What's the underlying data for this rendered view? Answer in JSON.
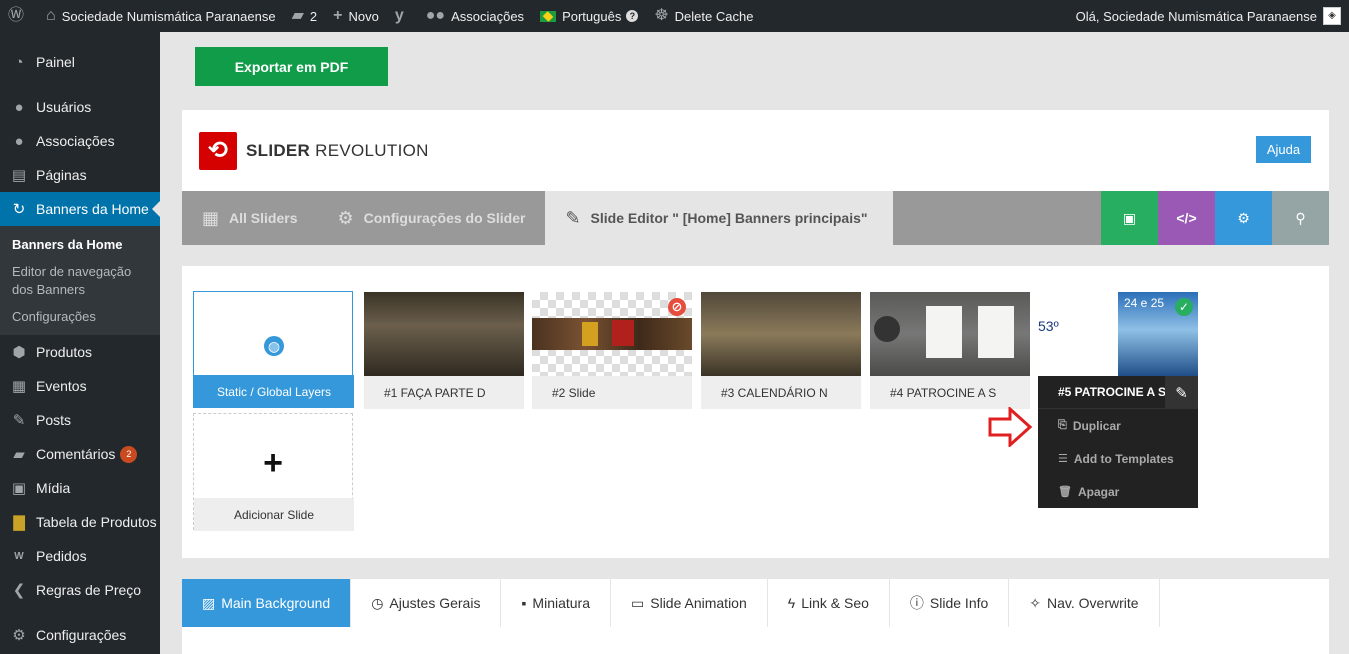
{
  "adminbar": {
    "site_name": "Sociedade Numismática Paranaense",
    "comments_count": "2",
    "new_label": "Novo",
    "associations_label": "Associações",
    "language_label": "Português",
    "delete_cache_label": "Delete Cache",
    "greeting": "Olá, Sociedade Numismática Paranaense"
  },
  "sidebar": {
    "items": [
      {
        "label": "Painel",
        "icon": "dashboard-icon"
      },
      {
        "label": "Usuários",
        "icon": "users-icon"
      },
      {
        "label": "Associações",
        "icon": "groups-icon"
      },
      {
        "label": "Páginas",
        "icon": "pages-icon"
      },
      {
        "label": "Banners da Home",
        "icon": "refresh-icon"
      }
    ],
    "submenu": [
      "Banners da Home",
      "Editor de navegação dos Banners",
      "Configurações"
    ],
    "items2": [
      {
        "label": "Produtos",
        "icon": "products-icon"
      },
      {
        "label": "Eventos",
        "icon": "calendar-icon"
      },
      {
        "label": "Posts",
        "icon": "pin-icon"
      },
      {
        "label": "Comentários",
        "icon": "comments-icon",
        "badge": "2"
      },
      {
        "label": "Mídia",
        "icon": "media-icon"
      },
      {
        "label": "Tabela de Produtos",
        "icon": "table-icon"
      },
      {
        "label": "Pedidos",
        "icon": "woo-icon"
      },
      {
        "label": "Regras de Preço",
        "icon": "chevron-left-icon"
      },
      {
        "label": "Configurações",
        "icon": "settings-icon"
      }
    ]
  },
  "export_button": "Exportar em PDF",
  "header": {
    "logo_bold": "SLIDER",
    "logo_light": "REVOLUTION",
    "help": "Ajuda"
  },
  "tabs": {
    "all_sliders": "All Sliders",
    "slider_settings": "Configurações do Slider",
    "slide_editor": "Slide Editor \" [Home] Banners principais\""
  },
  "toolbar_icons": [
    "save-icon",
    "code-icon",
    "gear-icon",
    "search-icon"
  ],
  "slides": {
    "static": "Static / Global Layers",
    "s1": "#1 FAÇA PARTE D",
    "s2": "#2 Slide",
    "s3": "#3 CALENDÁRIO N",
    "s4": "#4 PATROCINE A S",
    "s5": "#5 PATROCINE A S",
    "add": "Adicionar Slide",
    "banner_left": "53º",
    "banner_right": "24 e 25"
  },
  "context_menu": [
    "Duplicar",
    "Add to Templates",
    "Apagar"
  ],
  "bottom_tabs": [
    "Main Background",
    "Ajustes Gerais",
    "Miniatura",
    "Slide Animation",
    "Link & Seo",
    "Slide Info",
    "Nav. Overwrite"
  ],
  "colors": {
    "accent": "#3498db",
    "wp_active": "#0073aa",
    "export": "#109c48",
    "save": "#27ae60",
    "code": "#9b59b6",
    "gear": "#3498db",
    "search": "#95a5a6",
    "arrow": "#e02020"
  }
}
